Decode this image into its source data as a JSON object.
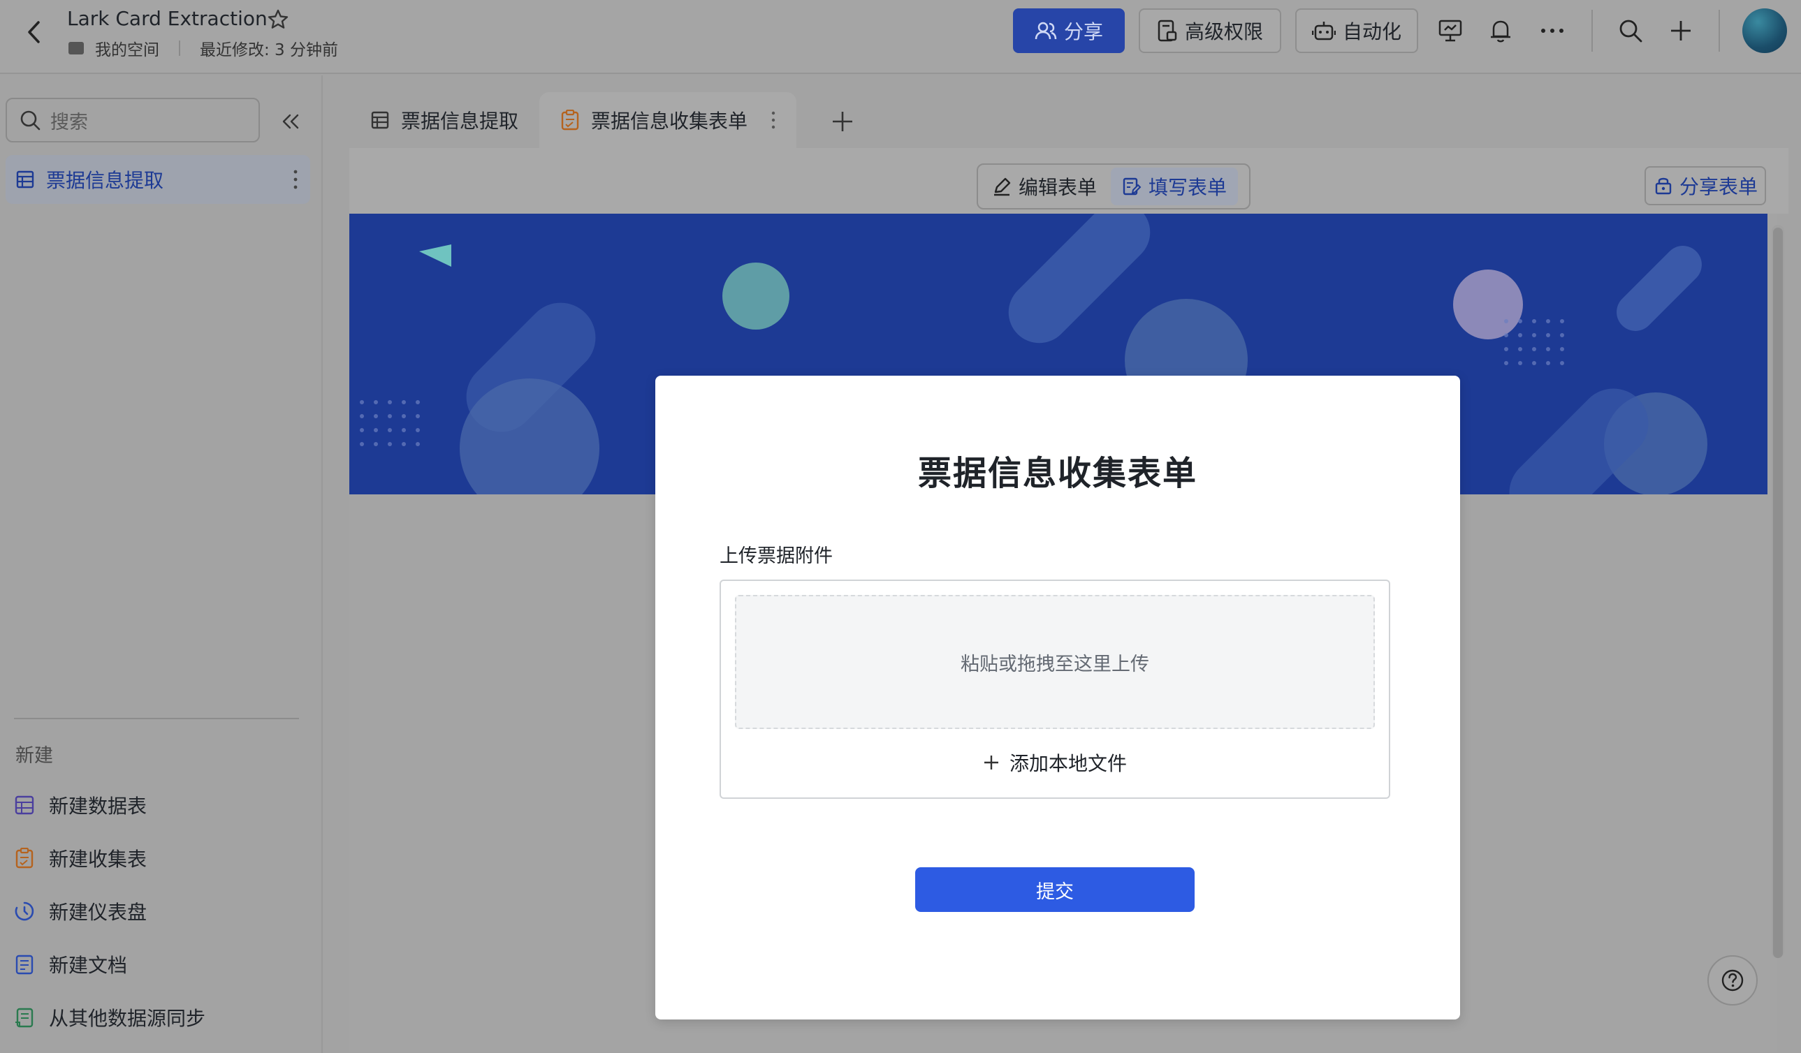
{
  "header": {
    "title": "Lark Card Extraction",
    "folder": "我的空间",
    "last_modified": "最近修改: 3 分钟前",
    "share_label": "分享",
    "permissions_label": "高级权限",
    "automation_label": "自动化"
  },
  "sidebar": {
    "search_placeholder": "搜索",
    "active_item": "票据信息提取",
    "new_section_label": "新建",
    "new_items": [
      {
        "label": "新建数据表",
        "icon": "table-icon",
        "color": "#5b4db3"
      },
      {
        "label": "新建收集表",
        "icon": "form-icon",
        "color": "#d07a2a"
      },
      {
        "label": "新建仪表盘",
        "icon": "dashboard-icon",
        "color": "#2f55c9"
      },
      {
        "label": "新建文档",
        "icon": "doc-icon",
        "color": "#2f55c9"
      },
      {
        "label": "从其他数据源同步",
        "icon": "sync-icon",
        "color": "#2f8a5b"
      }
    ]
  },
  "tabs": [
    {
      "label": "票据信息提取",
      "icon": "table-icon"
    },
    {
      "label": "票据信息收集表单",
      "icon": "form-icon",
      "active": true
    }
  ],
  "toolbar": {
    "edit_form_label": "编辑表单",
    "fill_form_label": "填写表单",
    "share_form_label": "分享表单"
  },
  "form": {
    "title": "票据信息收集表单",
    "field_label": "上传票据附件",
    "drop_hint": "粘贴或拖拽至这里上传",
    "add_local_label": "添加本地文件",
    "submit_label": "提交"
  },
  "colors": {
    "brand_blue": "#2d5be3",
    "banner_blue": "#1d3a94",
    "overlay_gray": "#a3a3a3"
  }
}
